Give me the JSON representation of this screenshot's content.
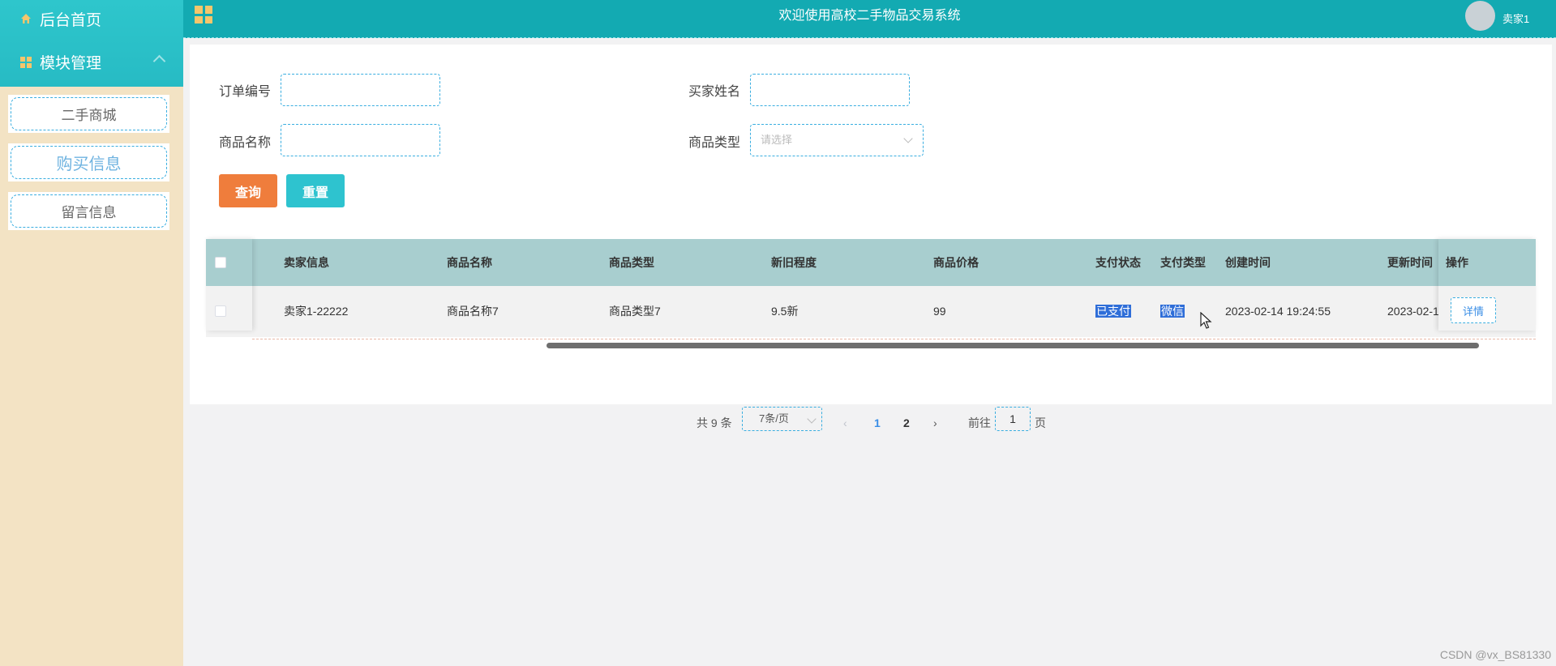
{
  "sidebar": {
    "home_label": "后台首页",
    "module_label": "模块管理",
    "items": [
      {
        "label": "二手商城"
      },
      {
        "label": "购买信息"
      },
      {
        "label": "留言信息"
      }
    ]
  },
  "header": {
    "title": "欢迎使用高校二手物品交易系统",
    "username": "卖家1"
  },
  "search": {
    "order_no_label": "订单编号",
    "buyer_name_label": "买家姓名",
    "product_name_label": "商品名称",
    "product_type_label": "商品类型",
    "product_type_placeholder": "请选择",
    "query_button": "查询",
    "reset_button": "重置"
  },
  "table": {
    "headers": [
      "卖家信息",
      "商品名称",
      "商品类型",
      "新旧程度",
      "商品价格",
      "支付状态",
      "支付类型",
      "创建时间",
      "更新时间",
      "操作"
    ],
    "rows": [
      {
        "seller": "卖家1-22222",
        "product_name": "商品名称7",
        "product_type": "商品类型7",
        "condition": "9.5新",
        "price": "99",
        "pay_status": "已支付",
        "pay_type": "微信",
        "created": "2023-02-14 19:24:55",
        "updated": "2023-02-1",
        "action": "详情"
      }
    ]
  },
  "pagination": {
    "total": "共 9 条",
    "page_size": "7条/页",
    "pages": [
      "1",
      "2"
    ],
    "goto_prefix": "前往",
    "goto_value": "1",
    "goto_suffix": "页"
  },
  "watermark": "CSDN @vx_BS81330",
  "colors": {
    "sidebar_bg": "#f3e3c4",
    "header_bg": "#13aab2",
    "query_btn": "#ef7d3c",
    "reset_btn": "#2ec3cf",
    "table_head": "#a8cecf"
  }
}
